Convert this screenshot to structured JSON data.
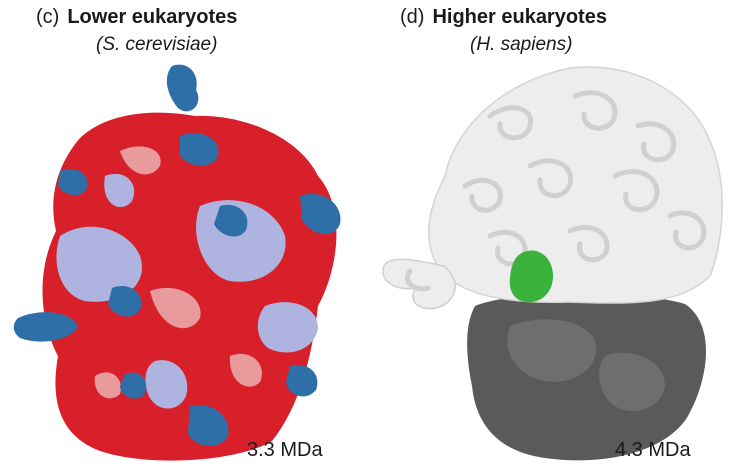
{
  "panels": [
    {
      "tag": "(c)",
      "title": "Lower eukaryotes",
      "species": "(S. cerevisiae)",
      "mass": "3.3 MDa",
      "colors": {
        "rRNA": "#d8202a",
        "rRNA_light": "#e89a9c",
        "protein_lavender": "#aeb4df",
        "protein_blue": "#2f6fa8"
      }
    },
    {
      "tag": "(d)",
      "title": "Higher eukaryotes",
      "species": "(H. sapiens)",
      "mass": "4.3 MDa",
      "colors": {
        "large_subunit": "#ededed",
        "small_subunit": "#5a5a5a",
        "highlight": "#3bb23b"
      }
    }
  ]
}
